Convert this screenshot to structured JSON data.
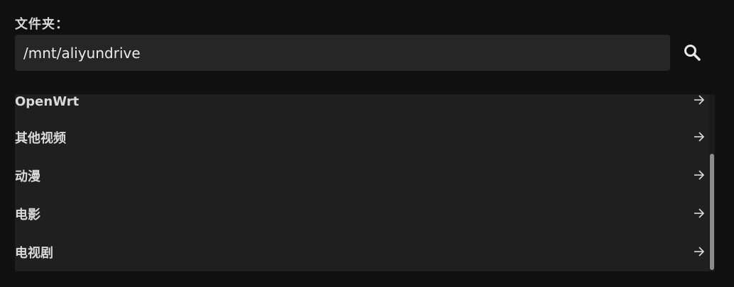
{
  "folder_field": {
    "label": "文件夹：",
    "value": "/mnt/aliyundrive"
  },
  "icons": {
    "search": "search-icon",
    "row_arrow": "arrow-right-icon"
  },
  "folders": [
    {
      "name": "OpenWrt"
    },
    {
      "name": "其他视频"
    },
    {
      "name": "动漫"
    },
    {
      "name": "电影"
    },
    {
      "name": "电视剧"
    }
  ]
}
